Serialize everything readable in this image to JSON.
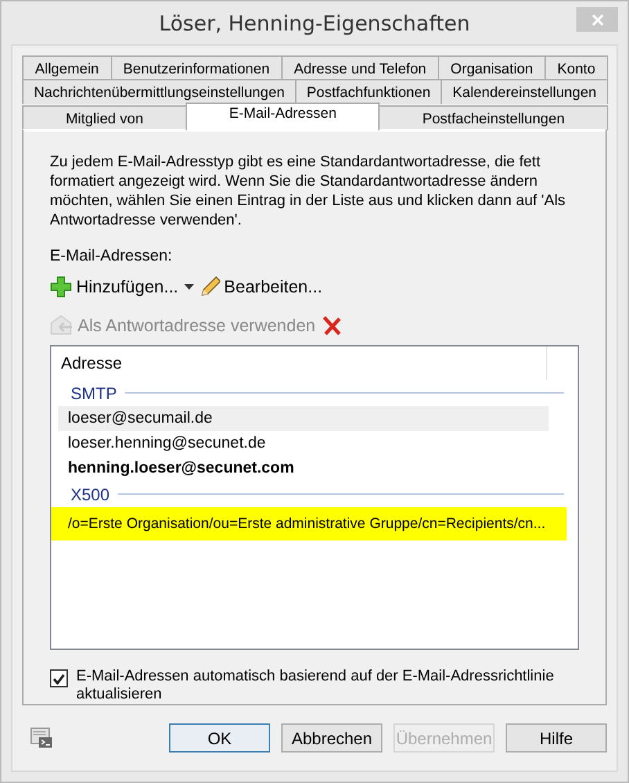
{
  "window": {
    "title": "Löser, Henning-Eigenschaften"
  },
  "tab_rows": [
    [
      {
        "label": "Allgemein",
        "selected": false
      },
      {
        "label": "Benutzerinformationen",
        "selected": false
      },
      {
        "label": "Adresse und Telefon",
        "selected": false
      },
      {
        "label": "Organisation",
        "selected": false
      },
      {
        "label": "Konto",
        "selected": false
      }
    ],
    [
      {
        "label": "Nachrichtenübermittlungseinstellungen",
        "selected": false
      },
      {
        "label": "Postfachfunktionen",
        "selected": false
      },
      {
        "label": "Kalendereinstellungen",
        "selected": false
      }
    ],
    [
      {
        "label": "Mitglied von",
        "selected": false
      },
      {
        "label": "E-Mail-Adressen",
        "selected": true
      },
      {
        "label": "Postfacheinstellungen",
        "selected": false
      }
    ]
  ],
  "description": "Zu jedem E-Mail-Adresstyp gibt es eine Standardantwortadresse, die fett formatiert angezeigt wird. Wenn Sie die Standardantwortadresse ändern möchten, wählen Sie einen Eintrag in der Liste aus und klicken dann auf 'Als Antwortadresse verwenden'.",
  "list_label": "E-Mail-Adressen:",
  "toolbar": [
    {
      "kind": "add",
      "label": "Hinzufügen...",
      "disabled": false
    },
    {
      "kind": "dropdown",
      "disabled": false
    },
    {
      "kind": "edit",
      "label": "Bearbeiten...",
      "disabled": false
    },
    {
      "kind": "reply",
      "label": "Als Antwortadresse verwenden",
      "disabled": true
    },
    {
      "kind": "delete",
      "disabled": false
    }
  ],
  "table": {
    "columns": [
      "Adresse"
    ],
    "groups": [
      {
        "name": "SMTP",
        "items": [
          {
            "address": "loeser@secumail.de",
            "bold": false,
            "hover": true,
            "highlighted": false
          },
          {
            "address": "loeser.henning@secunet.de",
            "bold": false,
            "hover": false,
            "highlighted": false
          },
          {
            "address": "henning.loeser@secunet.com",
            "bold": true,
            "hover": false,
            "highlighted": false
          }
        ]
      },
      {
        "name": "X500",
        "items": [
          {
            "address": "/o=Erste Organisation/ou=Erste administrative Gruppe/cn=Recipients/cn...",
            "bold": false,
            "hover": false,
            "highlighted": true
          }
        ]
      }
    ]
  },
  "auto_update": {
    "label": "E-Mail-Adressen automatisch basierend auf der E-Mail-Adressrichtlinie aktualisieren",
    "checked": true
  },
  "buttons": [
    {
      "label": "OK",
      "default": true,
      "disabled": false
    },
    {
      "label": "Abbrechen",
      "default": false,
      "disabled": false
    },
    {
      "label": "Übernehmen",
      "default": false,
      "disabled": true
    },
    {
      "label": "Hilfe",
      "default": false,
      "disabled": false
    }
  ]
}
